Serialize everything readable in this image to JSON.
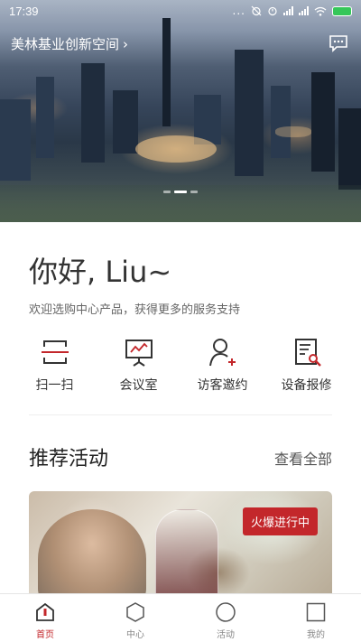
{
  "status_bar": {
    "time": "17:39",
    "dots": "...",
    "icons": [
      "alarm-off-icon",
      "alarm-icon",
      "signal-icon",
      "signal-icon",
      "wifi-icon",
      "battery-icon"
    ]
  },
  "header": {
    "location": "美林基业创新空间",
    "chevron": "›",
    "message_icon": "chat-icon"
  },
  "banner": {
    "page_indicator": {
      "count": 3,
      "active_index": 1
    }
  },
  "greeting": {
    "title": "你好, Liu~",
    "subtitle": "欢迎选购中心产品，获得更多的服务支持"
  },
  "quick_actions": [
    {
      "label": "扫一扫",
      "icon": "scan-icon"
    },
    {
      "label": "会议室",
      "icon": "meeting-room-icon"
    },
    {
      "label": "访客邀约",
      "icon": "visitor-invite-icon"
    },
    {
      "label": "设备报修",
      "icon": "repair-report-icon"
    }
  ],
  "recommend": {
    "title": "推荐活动",
    "see_all": "查看全部"
  },
  "activity_card": {
    "badge": "火爆进行中"
  },
  "tabs": [
    {
      "label": "首页",
      "icon": "home-icon",
      "active": true
    },
    {
      "label": "中心",
      "icon": "hexagon-icon",
      "active": false
    },
    {
      "label": "活动",
      "icon": "circle-icon",
      "active": false
    },
    {
      "label": "我的",
      "icon": "square-icon",
      "active": false
    }
  ],
  "colors": {
    "accent": "#c3272b",
    "text": "#333333",
    "muted": "#666666"
  }
}
